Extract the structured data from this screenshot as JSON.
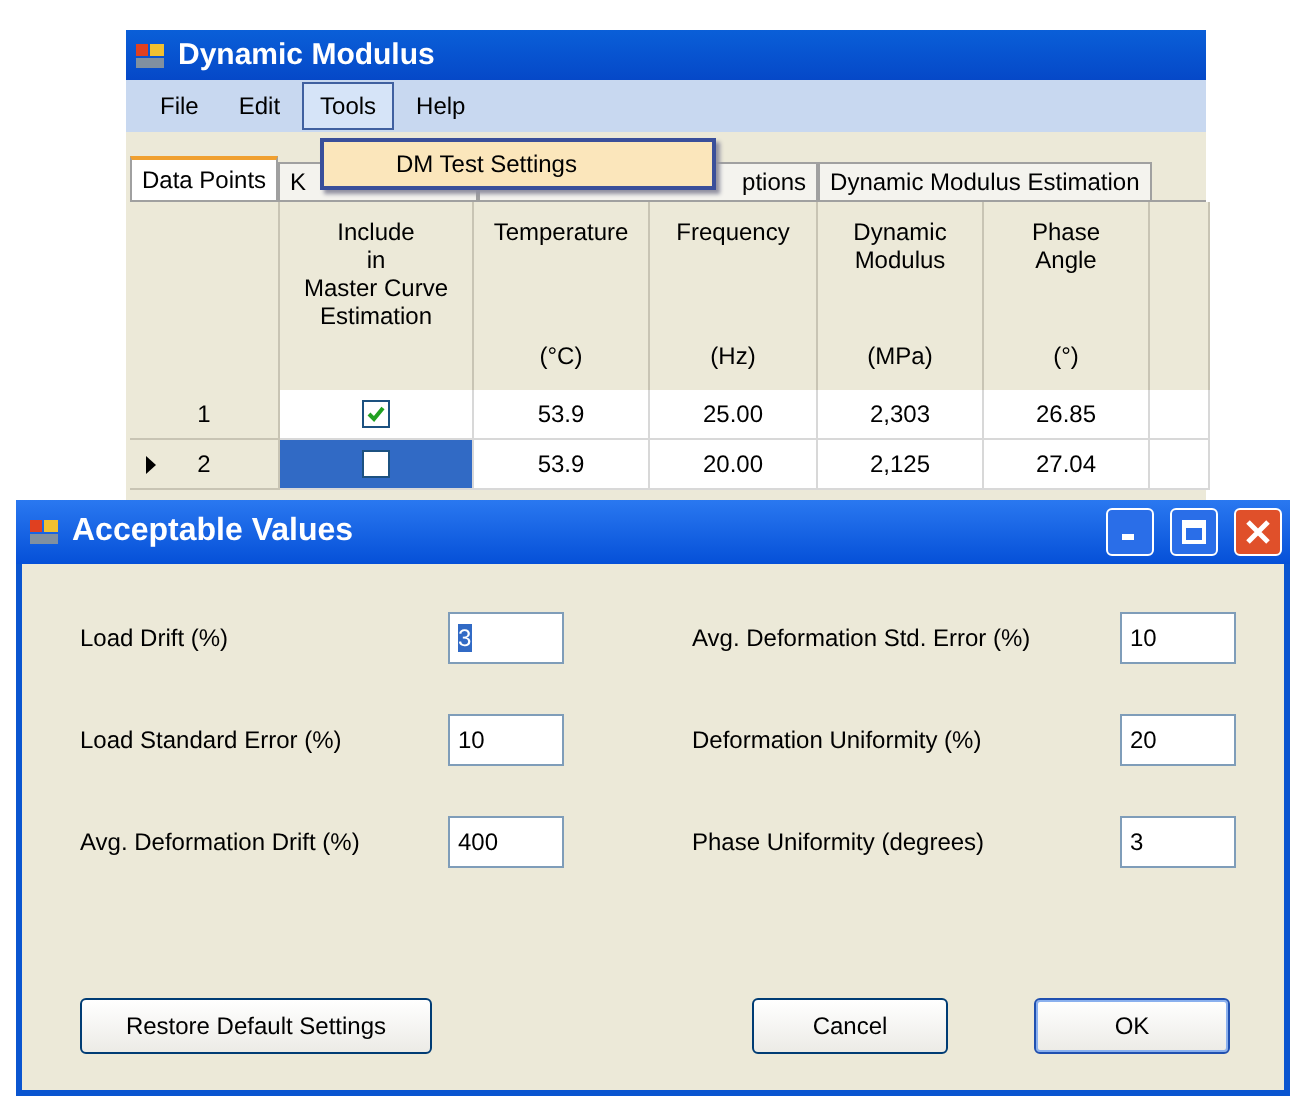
{
  "main_window": {
    "title": "Dynamic Modulus",
    "menu": [
      {
        "label": "File",
        "selected": false
      },
      {
        "label": "Edit",
        "selected": false
      },
      {
        "label": "Tools",
        "selected": true
      },
      {
        "label": "Help",
        "selected": false
      }
    ],
    "dropdown": {
      "items": [
        "DM Test Settings"
      ]
    },
    "tabs": [
      {
        "label": "Data Points",
        "selected": true
      },
      {
        "label": "K",
        "selected": false
      },
      {
        "label": "ptions",
        "selected": false
      },
      {
        "label": "Dynamic Modulus Estimation",
        "selected": false
      }
    ],
    "table": {
      "columns": [
        {
          "title": "Include\nin\nMaster Curve\nEstimation"
        },
        {
          "title": "Temperature",
          "unit": "(°C)"
        },
        {
          "title": "Frequency",
          "unit": "(Hz)"
        },
        {
          "title": "Dynamic\nModulus",
          "unit": "(MPa)"
        },
        {
          "title": "Phase\nAngle",
          "unit": "(°)"
        }
      ],
      "rows": [
        {
          "number": "1",
          "selected": false,
          "cells": [
            {
              "kind": "checkbox",
              "checked": true
            },
            {
              "kind": "text",
              "text": "53.9"
            },
            {
              "kind": "text",
              "text": "25.00"
            },
            {
              "kind": "text",
              "text": "2,303"
            },
            {
              "kind": "text",
              "text": "26.85"
            }
          ]
        },
        {
          "number": "2",
          "selected": true,
          "cells": [
            {
              "kind": "checkbox",
              "checked": false
            },
            {
              "kind": "text",
              "text": "53.9"
            },
            {
              "kind": "text",
              "text": "20.00"
            },
            {
              "kind": "text",
              "text": "2,125"
            },
            {
              "kind": "text",
              "text": "27.04"
            }
          ]
        }
      ]
    }
  },
  "dialog": {
    "title": "Acceptable Values",
    "fields": [
      {
        "label": "Load Drift (%)",
        "value": "3",
        "highlighted": true
      },
      {
        "label": "Avg. Deformation Std. Error (%)",
        "value": "10",
        "highlighted": false
      },
      {
        "label": "Load Standard Error (%)",
        "value": "10",
        "highlighted": false
      },
      {
        "label": "Deformation Uniformity (%)",
        "value": "20",
        "highlighted": false
      },
      {
        "label": "Avg. Deformation Drift (%)",
        "value": "400",
        "highlighted": false
      },
      {
        "label": "Phase Uniformity (degrees)",
        "value": "3",
        "highlighted": false
      }
    ],
    "buttons": [
      {
        "label": "Restore Default Settings",
        "kind": "left"
      },
      {
        "label": "Cancel",
        "kind": "right"
      },
      {
        "label": "OK",
        "kind": "default"
      }
    ]
  }
}
